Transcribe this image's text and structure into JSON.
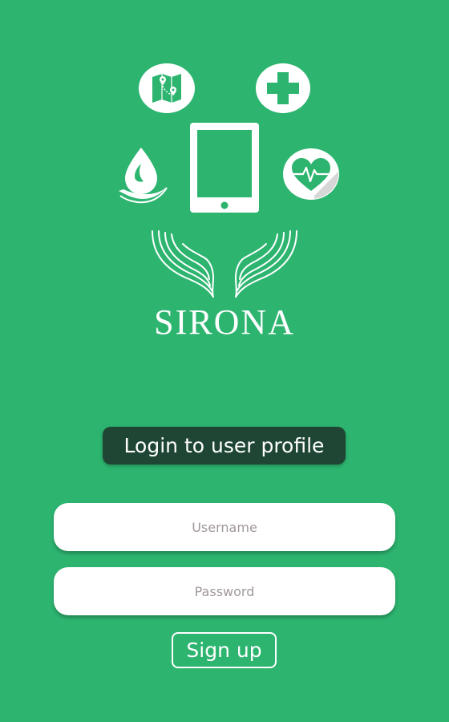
{
  "app": {
    "brand_name": "SIRONA",
    "background_color": "#2db570"
  },
  "logo": {
    "icons": [
      "map-pin-icon",
      "medical-cross-icon",
      "water-drop-hand-icon",
      "tablet-icon",
      "heartbeat-icon",
      "caring-hands-icon"
    ]
  },
  "login": {
    "title": "Login to user profile",
    "title_bg_color": "#1f4634",
    "username_placeholder": "Username",
    "password_placeholder": "Password",
    "signup_label": "Sign up"
  }
}
